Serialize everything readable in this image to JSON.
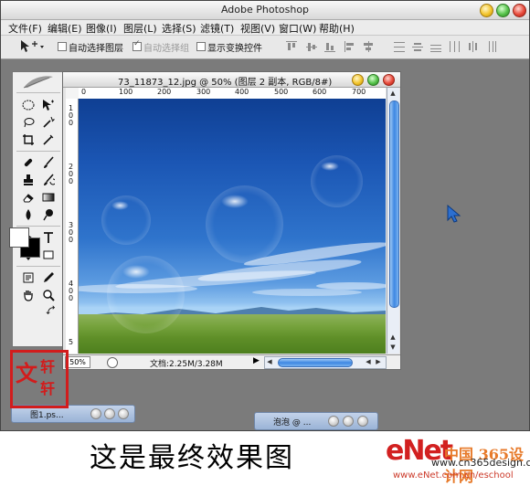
{
  "app": {
    "title": "Adobe Photoshop"
  },
  "menu": [
    "文件(F)",
    "编辑(E)",
    "图像(I)",
    "图层(L)",
    "选择(S)",
    "滤镜(T)",
    "视图(V)",
    "窗口(W)",
    "帮助(H)"
  ],
  "options": {
    "auto_select_layer": {
      "label": "自动选择图层",
      "checked": false
    },
    "auto_select_group": {
      "label": "自动选择组",
      "checked": true,
      "disabled": true
    },
    "show_transform": {
      "label": "显示变换控件",
      "checked": false
    }
  },
  "document": {
    "title": "73_11873_12.jpg @ 50% (图层 2 副本, RGB/8#)",
    "ruler_top": [
      "0",
      "100",
      "200",
      "300",
      "400",
      "500",
      "600",
      "700"
    ],
    "ruler_left": [
      "1",
      "0",
      "0",
      "2",
      "0",
      "0",
      "3",
      "0",
      "0",
      "4",
      "0",
      "0",
      "5"
    ],
    "zoom": "50%",
    "doc_info": "文档:2.25M/3.28M"
  },
  "minimized": [
    {
      "label": "图1.ps..."
    },
    {
      "label": "泡泡 @ ..."
    }
  ],
  "stamp": {
    "chars": [
      "文",
      "轩",
      "轩"
    ]
  },
  "caption": "这是最终效果图",
  "watermark": {
    "logo": "eNet",
    "cn": "中国 365设计网",
    "site": "www.cn365design.com",
    "url": "www.eNet.com.cn/eschool"
  },
  "colors": {
    "accent": "#3e87e2",
    "stamp": "#d21c1c",
    "workspace": "#7b7b7b"
  }
}
